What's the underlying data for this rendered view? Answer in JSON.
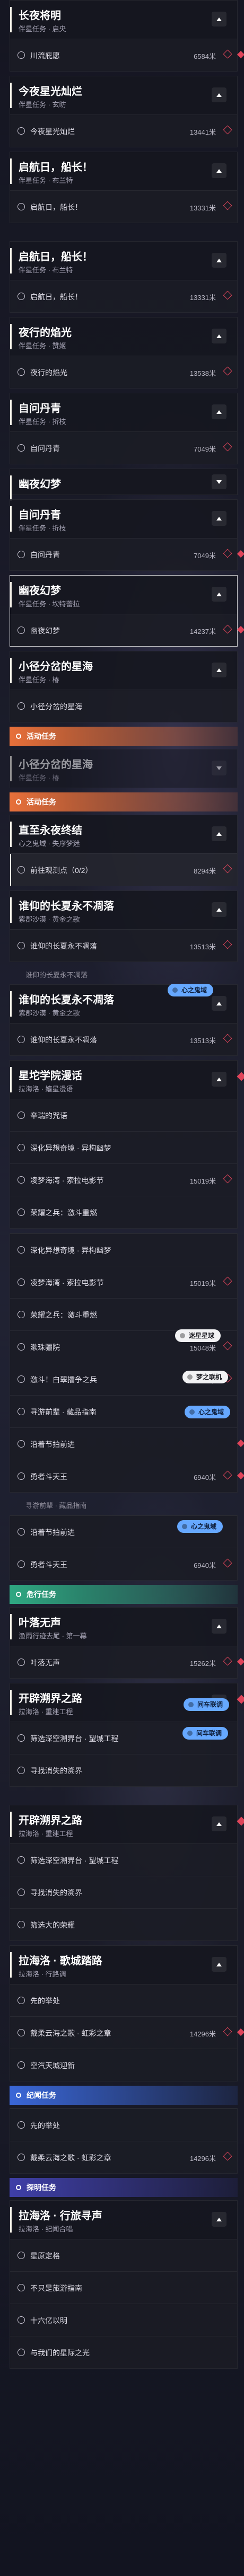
{
  "tags": [
    {
      "label": "心之鬼域",
      "style": "blue"
    },
    {
      "label": "迷星星球",
      "style": "white"
    },
    {
      "label": "梦之联机",
      "style": "white"
    },
    {
      "label": "心之鬼域",
      "style": "blue"
    },
    {
      "label": "心之鬼域",
      "style": "blue"
    },
    {
      "label": "间车联调",
      "style": "blue"
    },
    {
      "label": "间车联调",
      "style": "blue"
    }
  ],
  "stream": [
    {
      "kind": "mission",
      "title": "长夜将明",
      "sub": "伴星任务 · 启央",
      "expanded": true,
      "selected": false,
      "diamond": false,
      "steps": [
        {
          "label": "川流庇愿",
          "dist": "6584米",
          "active": false,
          "pin": true,
          "diamond": true
        }
      ]
    },
    {
      "kind": "mission",
      "title": "今夜星光灿烂",
      "sub": "伴星任务 · 玄昉",
      "expanded": true,
      "selected": false,
      "diamond": false,
      "steps": [
        {
          "label": "今夜星光灿烂",
          "dist": "13441米",
          "active": false,
          "pin": true,
          "diamond": false
        }
      ]
    },
    {
      "kind": "mission",
      "title": "启航日，船长！",
      "sub": "伴星任务 · 布兰特",
      "expanded": true,
      "selected": false,
      "diamond": false,
      "steps": [
        {
          "label": "启航日，船长！",
          "dist": "13331米",
          "active": false,
          "pin": true,
          "diamond": false
        }
      ]
    },
    {
      "kind": "spacer"
    },
    {
      "kind": "mission",
      "title": "启航日，船长！",
      "sub": "伴星任务 · 布兰特",
      "expanded": true,
      "selected": false,
      "diamond": false,
      "steps": [
        {
          "label": "启航日，船长！",
          "dist": "13331米",
          "active": false,
          "pin": true,
          "diamond": false
        }
      ]
    },
    {
      "kind": "mission",
      "title": "夜行的焰光",
      "sub": "伴星任务 · 赞姬",
      "expanded": true,
      "selected": false,
      "diamond": false,
      "steps": [
        {
          "label": "夜行的焰光",
          "dist": "13538米",
          "active": false,
          "pin": true,
          "diamond": false
        }
      ]
    },
    {
      "kind": "mission",
      "title": "自问丹青",
      "sub": "伴星任务 · 折枝",
      "expanded": true,
      "selected": false,
      "diamond": false,
      "steps": [
        {
          "label": "自问丹青",
          "dist": "7049米",
          "active": false,
          "pin": true,
          "diamond": false
        }
      ]
    },
    {
      "kind": "mission",
      "title": "幽夜幻梦",
      "sub": "",
      "expanded": false,
      "selected": false,
      "diamond": false,
      "steps": []
    },
    {
      "kind": "mission",
      "title": "自问丹青",
      "sub": "伴星任务 · 折枝",
      "expanded": true,
      "selected": false,
      "diamond": false,
      "steps": [
        {
          "label": "自问丹青",
          "dist": "7049米",
          "active": false,
          "pin": true,
          "diamond": true
        }
      ]
    },
    {
      "kind": "mission",
      "title": "幽夜幻梦",
      "sub": "伴星任务 · 坎特蕾拉",
      "expanded": true,
      "selected": true,
      "diamond": false,
      "steps": [
        {
          "label": "幽夜幻梦",
          "dist": "14237米",
          "active": false,
          "pin": true,
          "diamond": true
        }
      ]
    },
    {
      "kind": "mission",
      "title": "小径分岔的星海",
      "sub": "伴星任务 · 椿",
      "expanded": true,
      "selected": false,
      "diamond": false,
      "steps": [
        {
          "label": "小径分岔的星海",
          "dist": "",
          "active": false,
          "pin": false,
          "diamond": false
        }
      ]
    },
    {
      "kind": "header",
      "label": "活动任务",
      "style": "cls-orange"
    },
    {
      "kind": "mission",
      "title": "小径分岔的星海",
      "sub": "伴星任务 · 椿",
      "expanded": false,
      "selected": false,
      "diamond": false,
      "steps": [],
      "dim": true
    },
    {
      "kind": "header",
      "label": "活动任务",
      "style": "cls-orange"
    },
    {
      "kind": "mission",
      "title": "直至永夜终结",
      "sub": "心之鬼域 · 失序梦迷",
      "expanded": true,
      "selected": false,
      "diamond": false,
      "steps": [
        {
          "label": "前往观测点（0/2）",
          "dist": "8294米",
          "active": true,
          "pin": true,
          "diamond": false
        }
      ]
    },
    {
      "kind": "mission",
      "title": "谁仰的长夏永不凋落",
      "sub": "紫郡沙漠 · 黄金之歌",
      "expanded": true,
      "selected": false,
      "diamond": false,
      "steps": [
        {
          "label": "谁仰的长夏永不凋落",
          "dist": "13513米",
          "active": false,
          "pin": true,
          "diamond": false
        }
      ]
    },
    {
      "kind": "ghost",
      "label": "谁仰的长夏永不凋落"
    },
    {
      "kind": "mission",
      "title": "谁仰的长夏永不凋落",
      "sub": "紫郡沙漠 · 黄金之歌",
      "expanded": true,
      "selected": false,
      "diamond": false,
      "steps": [
        {
          "label": "谁仰的长夏永不凋落",
          "dist": "13513米",
          "active": false,
          "pin": true,
          "diamond": false
        }
      ]
    },
    {
      "kind": "mission",
      "title": "星坨学院漫话",
      "sub": "拉海洛 · 嬉星漫语",
      "expanded": true,
      "selected": false,
      "diamond": true,
      "steps": [
        {
          "label": "辛瑞的咒语",
          "dist": "",
          "active": false,
          "pin": false,
          "diamond": false
        },
        {
          "label": "深化异想奇境 · 异构幽梦",
          "dist": "",
          "active": false,
          "pin": false,
          "diamond": false
        },
        {
          "label": "凌梦海湾 · 索拉电影节",
          "dist": "15019米",
          "active": false,
          "pin": true,
          "diamond": false
        },
        {
          "label": "荣耀之兵：激斗重燃",
          "dist": "",
          "active": false,
          "pin": false,
          "diamond": false
        }
      ]
    },
    {
      "kind": "mission",
      "title": "",
      "sub": "",
      "expanded": true,
      "selected": false,
      "diamond": false,
      "headless": true,
      "steps": [
        {
          "label": "深化异想奇境 · 异构幽梦",
          "dist": "",
          "active": false,
          "pin": false,
          "diamond": false
        },
        {
          "label": "凌梦海湾 · 索拉电影节",
          "dist": "15019米",
          "active": false,
          "pin": true,
          "diamond": false
        },
        {
          "label": "荣耀之兵：激斗重燃",
          "dist": "",
          "active": false,
          "pin": false,
          "diamond": false
        },
        {
          "label": "漱珠骊院",
          "dist": "15048米",
          "active": false,
          "pin": true,
          "diamond": false
        },
        {
          "label": "激斗！白翠擂争之兵",
          "dist": "21435米",
          "active": false,
          "pin": true,
          "diamond": false
        },
        {
          "label": "寻游前辈 · 藏品指南",
          "dist": "",
          "active": false,
          "pin": false,
          "diamond": false
        },
        {
          "label": "沿着节拍前进",
          "dist": "",
          "active": false,
          "pin": false,
          "diamond": true
        },
        {
          "label": "勇者斗天王",
          "dist": "6940米",
          "active": false,
          "pin": true,
          "diamond": true
        }
      ]
    },
    {
      "kind": "ghost",
      "label": "寻游前辈 · 藏品指南"
    },
    {
      "kind": "mission",
      "title": "",
      "sub": "",
      "expanded": true,
      "selected": false,
      "diamond": false,
      "headless": true,
      "steps": [
        {
          "label": "沿着节拍前进",
          "dist": "",
          "active": false,
          "pin": false,
          "diamond": false
        },
        {
          "label": "勇者斗天王",
          "dist": "6940米",
          "active": false,
          "pin": true,
          "diamond": false
        }
      ]
    },
    {
      "kind": "header",
      "label": "危行任务",
      "style": "cls-green"
    },
    {
      "kind": "mission",
      "title": "叶落无声",
      "sub": "渔雨行迹去尾 · 第一幕",
      "expanded": true,
      "selected": false,
      "diamond": false,
      "steps": [
        {
          "label": "叶落无声",
          "dist": "15262米",
          "active": false,
          "pin": true,
          "diamond": true
        }
      ]
    },
    {
      "kind": "mission",
      "title": "开辟溯界之路",
      "sub": "拉海洛 · 重建工程",
      "expanded": true,
      "selected": false,
      "diamond": true,
      "steps": [
        {
          "label": "筛选深空溯界台 · 望城工程",
          "dist": "",
          "active": false,
          "pin": false,
          "diamond": false
        },
        {
          "label": "寻找消失的溯界",
          "dist": "",
          "active": false,
          "pin": false,
          "diamond": false
        }
      ]
    },
    {
      "kind": "spacer"
    },
    {
      "kind": "mission",
      "title": "开辟溯界之路",
      "sub": "拉海洛 · 重建工程",
      "expanded": true,
      "selected": false,
      "diamond": true,
      "steps": [
        {
          "label": "筛选深空溯界台 · 望城工程",
          "dist": "",
          "active": false,
          "pin": false,
          "diamond": false
        },
        {
          "label": "寻找消失的溯界",
          "dist": "",
          "active": false,
          "pin": false,
          "diamond": false
        },
        {
          "label": "筛选大的荣耀",
          "dist": "",
          "active": false,
          "pin": false,
          "diamond": false
        }
      ]
    },
    {
      "kind": "mission",
      "title": "拉海洛 · 歌城踏路",
      "sub": "拉海洛 · 行路调",
      "expanded": true,
      "selected": false,
      "diamond": false,
      "steps": [
        {
          "label": "先的举处",
          "dist": "",
          "active": false,
          "pin": false,
          "diamond": false
        },
        {
          "label": "戴柔云海之歌 · 虹彩之章",
          "dist": "14296米",
          "active": false,
          "pin": true,
          "diamond": true
        },
        {
          "label": "空汽天城迎新",
          "dist": "",
          "active": false,
          "pin": false,
          "diamond": false
        }
      ]
    },
    {
      "kind": "header",
      "label": "纪闻任务",
      "style": "cls-blue"
    },
    {
      "kind": "mission",
      "title": "",
      "sub": "",
      "expanded": true,
      "selected": false,
      "diamond": false,
      "headless": true,
      "steps": [
        {
          "label": "先的举处",
          "dist": "",
          "active": false,
          "pin": false,
          "diamond": false
        },
        {
          "label": "戴柔云海之歌 · 虹彩之章",
          "dist": "14296米",
          "active": false,
          "pin": true,
          "diamond": false
        }
      ]
    },
    {
      "kind": "header",
      "label": "探明任务",
      "style": "cls-violet"
    },
    {
      "kind": "mission",
      "title": "拉海洛 · 行旅寻声",
      "sub": "拉海洛 · 纪闻合唱",
      "expanded": true,
      "selected": false,
      "diamond": false,
      "steps": [
        {
          "label": "星原定格",
          "dist": "",
          "active": false,
          "pin": false,
          "diamond": false
        },
        {
          "label": "不只是旅游指南",
          "dist": "",
          "active": false,
          "pin": false,
          "diamond": false
        },
        {
          "label": "十六亿以明",
          "dist": "",
          "active": false,
          "pin": false,
          "diamond": false
        },
        {
          "label": "与我们的星际之光",
          "dist": "",
          "active": false,
          "pin": false,
          "diamond": false
        }
      ]
    }
  ]
}
